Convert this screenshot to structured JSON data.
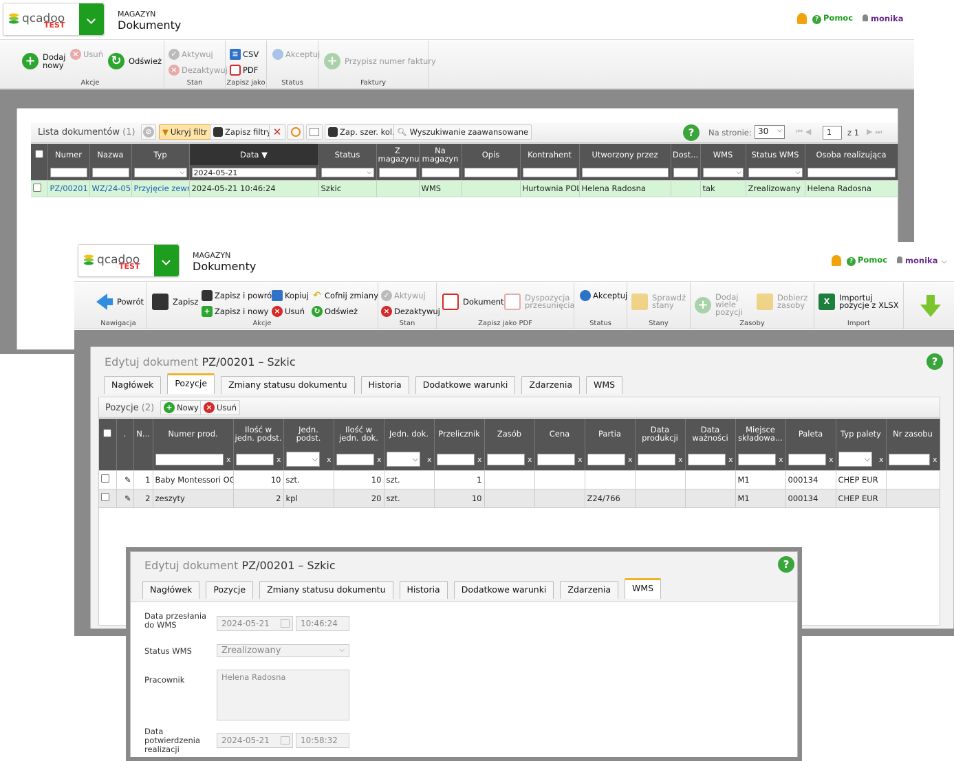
{
  "logo": {
    "brand": "qcadoo",
    "tag": "TEST"
  },
  "header": {
    "module": "MAGAZYN",
    "title": "Dokumenty",
    "help": "Pomoc",
    "user": "monika"
  },
  "back_ribbon": {
    "add_new": "Dodaj nowy",
    "delete": "Usuń",
    "refresh": "Odśwież",
    "activate": "Aktywuj",
    "deactivate": "Dezaktywuj",
    "csv": "CSV",
    "pdf": "PDF",
    "accept": "Akceptuj",
    "invoice": "Przypisz numer faktury",
    "g_actions": "Akcje",
    "g_state": "Stan",
    "g_save_as": "Zapisz jako",
    "g_status": "Status",
    "g_invoices": "Faktury"
  },
  "list": {
    "title": "Lista dokumentów",
    "count": "(1)",
    "hide_filter": "Ukryj filtr",
    "save_filters": "Zapisz filtry",
    "save_cols": "Zap. szer. kol.",
    "adv_search": "Wyszukiwanie zaawansowane",
    "per_page_label": "Na stronie:",
    "per_page": "30",
    "page": "1",
    "of_pages": "z 1",
    "columns": [
      "Numer",
      "Nazwa",
      "Typ",
      "Data",
      "Status",
      "Z magazynu",
      "Na magazyn",
      "Opis",
      "Kontrahent",
      "Utworzony przez",
      "Dost...",
      "WMS",
      "Status WMS",
      "Osoba realizująca"
    ],
    "date_filter": "2024-05-21",
    "row": [
      "PZ/00201",
      "WZ/24-05-",
      "Przyjęcie zewnę",
      "2024-05-21 10:46:24",
      "Szkic",
      "",
      "WMS",
      "",
      "Hurtownia POLA",
      "Helena Radosna",
      "",
      "tak",
      "Zrealizowany",
      "Helena Radosna"
    ]
  },
  "mid_ribbon": {
    "back": "Powrót",
    "save": "Zapisz",
    "save_back": "Zapisz i powrót",
    "save_new": "Zapisz i nowy",
    "copy": "Kopiuj",
    "delete": "Usuń",
    "undo": "Cofnij zmiany",
    "refresh": "Odśwież",
    "activate": "Aktywuj",
    "deactivate": "Dezaktywuj",
    "document": "Dokument",
    "disposition": "Dyspozycja przesunięcia",
    "accept": "Akceptuj",
    "check_stock": "Sprawdź stany",
    "add_many": "Dodaj wiele pozycji",
    "pick_res": "Dobierz zasoby",
    "import": "Importuj pozycje z XLSX",
    "g_nav": "Nawigacja",
    "g_actions": "Akcje",
    "g_state": "Stan",
    "g_pdf": "Zapisz jako PDF",
    "g_status": "Status",
    "g_stock": "Stany",
    "g_res": "Zasoby",
    "g_import": "Import"
  },
  "edit": {
    "prefix": "Edytuj dokument",
    "doc": "PZ/00201 – Szkic",
    "tabs": [
      "Nagłówek",
      "Pozycje",
      "Zmiany statusu dokumentu",
      "Historia",
      "Dodatkowe warunki",
      "Zdarzenia",
      "WMS"
    ]
  },
  "positions": {
    "title": "Pozycje",
    "count": "(2)",
    "new": "Nowy",
    "delete": "Usuń",
    "columns": [
      ".",
      "N...",
      "Numer prod.",
      "Ilość w jedn. podst.",
      "Jedn. podst.",
      "Ilość w jedn. dok.",
      "Jedn. dok.",
      "Przelicznik",
      "Zasób",
      "Cena",
      "Partia",
      "Data produkcji",
      "Data ważności",
      "Miejsce składowa...",
      "Paleta",
      "Typ palety",
      "Nr zasobu"
    ],
    "rows": [
      [
        "1",
        "Baby Montessori OG",
        "10",
        "szt.",
        "10",
        "szt.",
        "1",
        "",
        "",
        "",
        "",
        "",
        "M1",
        "000134",
        "CHEP EUR",
        ""
      ],
      [
        "2",
        "zeszyty",
        "2",
        "kpl",
        "20",
        "szt.",
        "10",
        "",
        "",
        "Z24/766",
        "",
        "",
        "M1",
        "000134",
        "CHEP EUR",
        ""
      ]
    ]
  },
  "wms": {
    "sent_label": "Data przesłania do WMS",
    "sent_date": "2024-05-21",
    "sent_time": "10:46:24",
    "status_label": "Status WMS",
    "status": "Zrealizowany",
    "worker_label": "Pracownik",
    "worker": "Helena Radosna",
    "confirm_label": "Data potwierdzenia realizacji",
    "confirm_date": "2024-05-21",
    "confirm_time": "10:58:32"
  }
}
